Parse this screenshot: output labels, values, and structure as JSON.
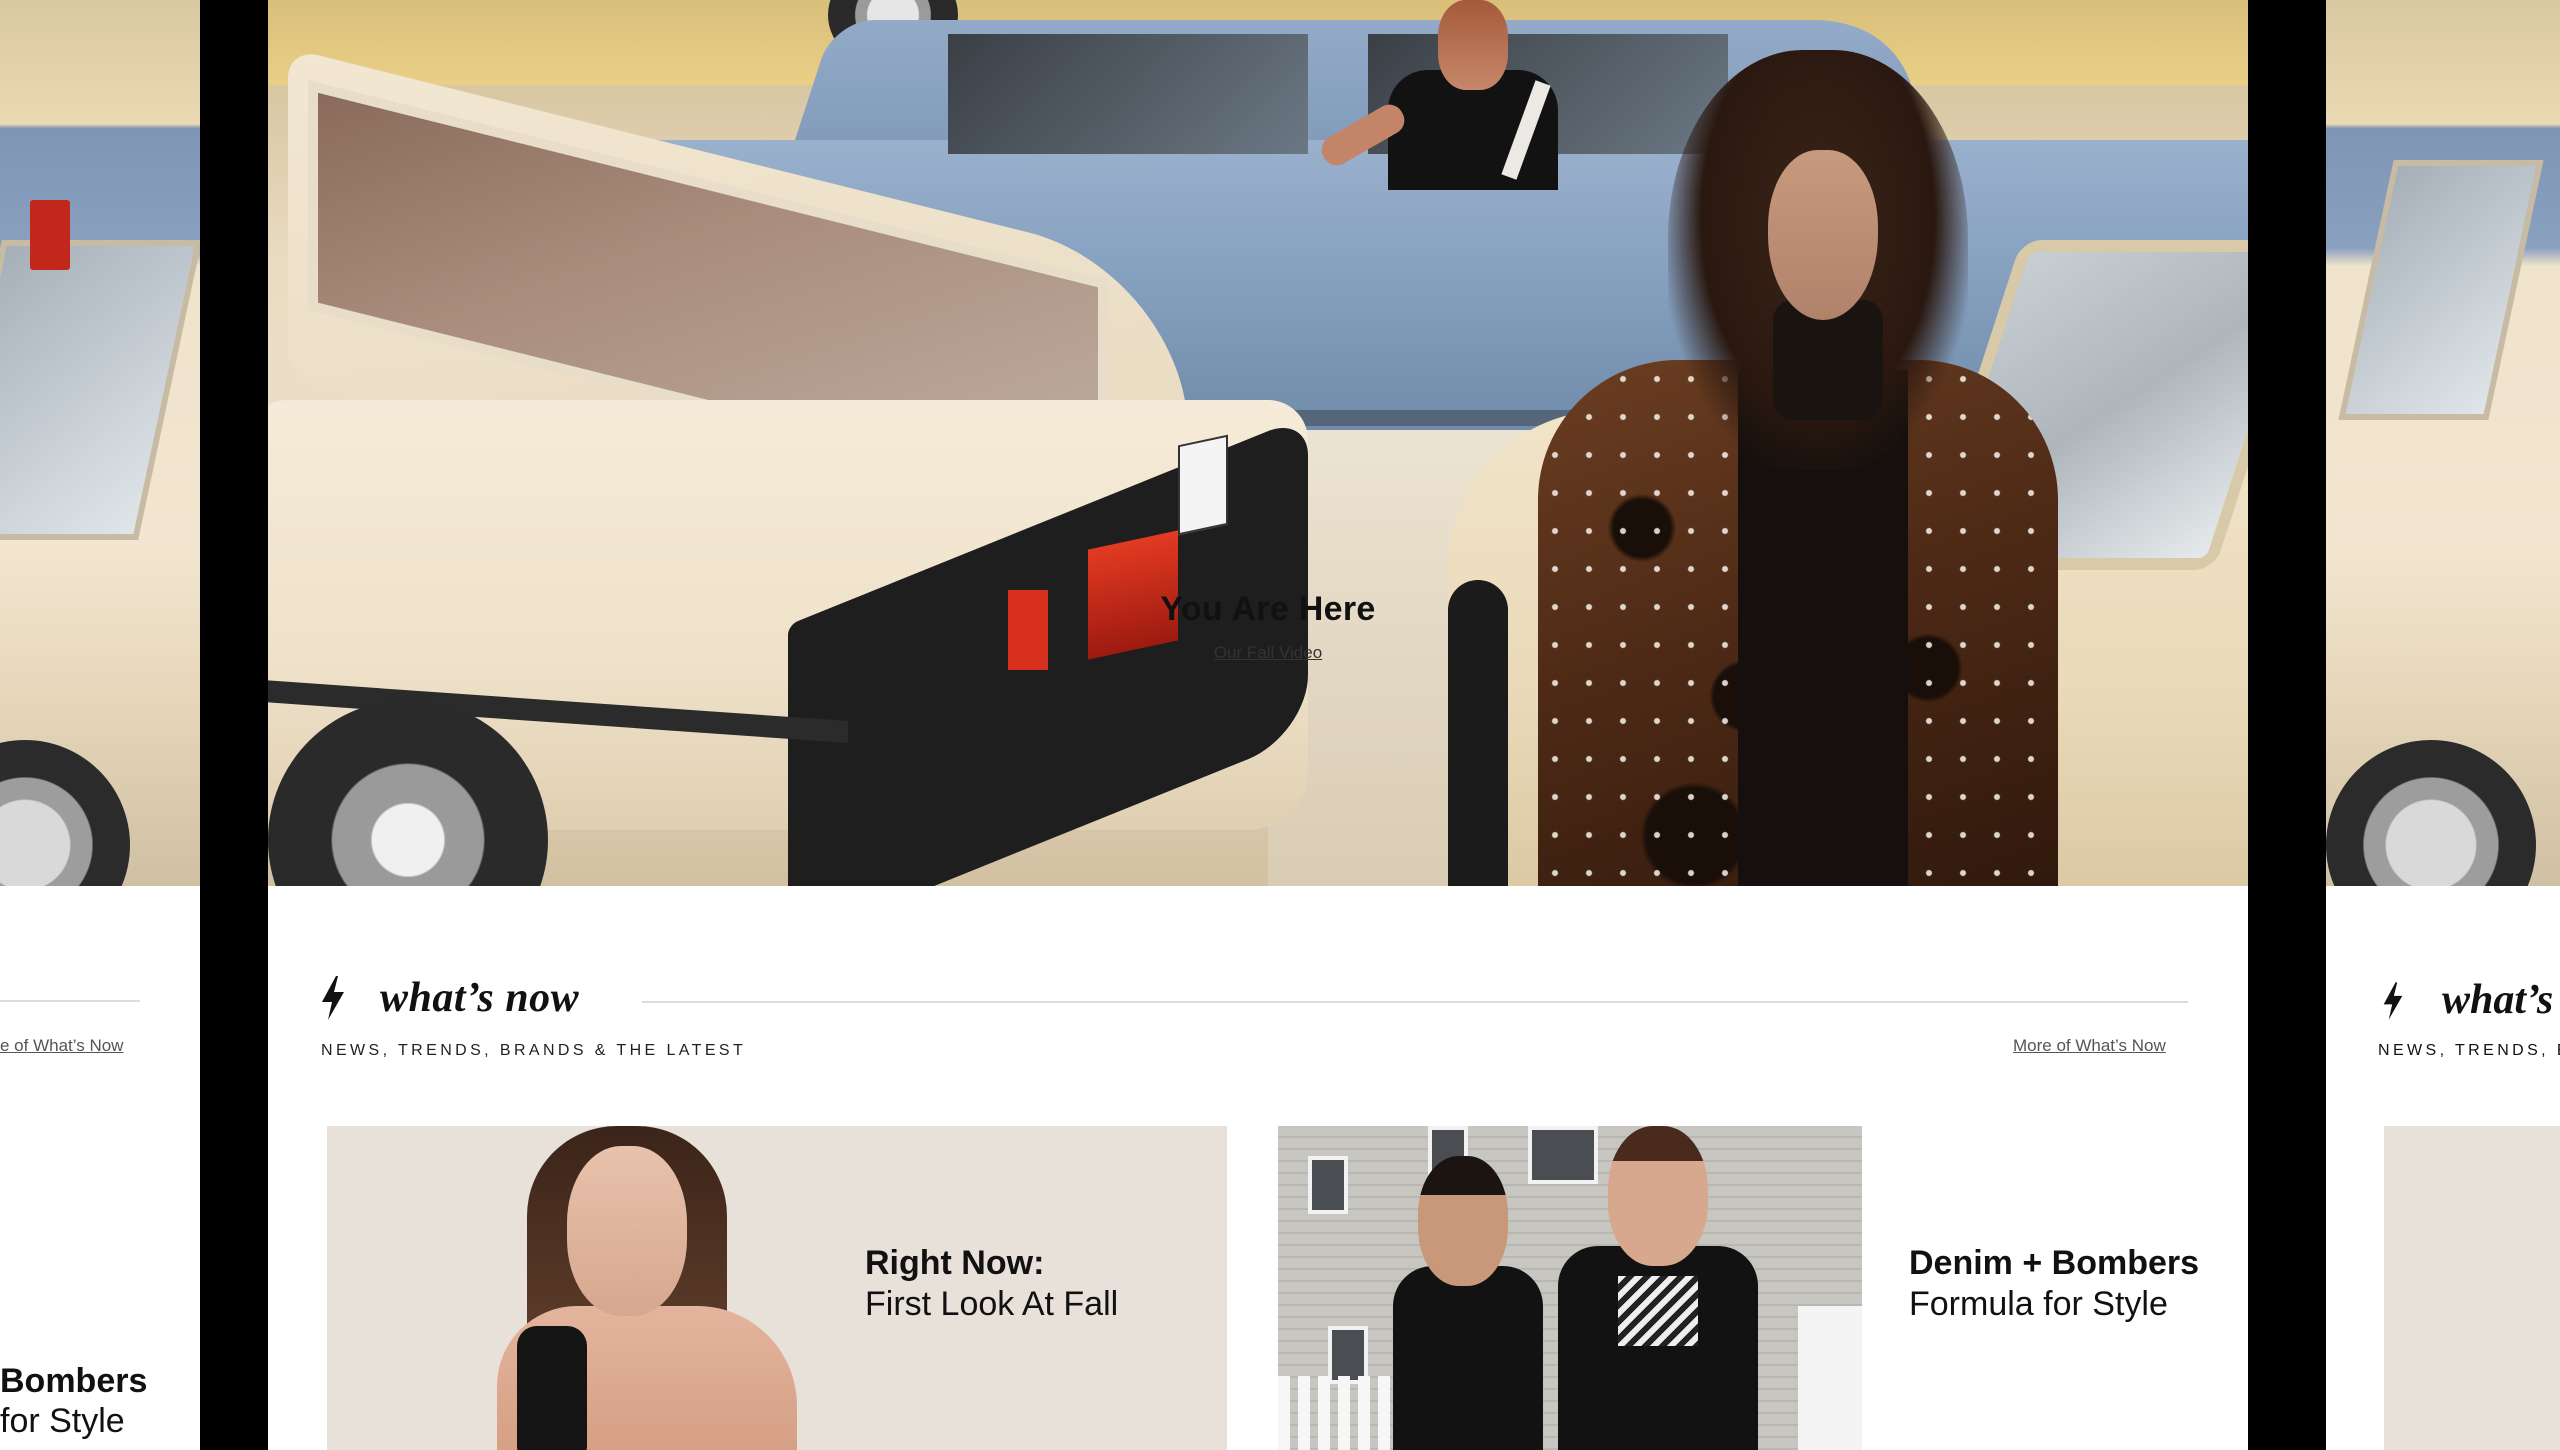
{
  "hero": {
    "title": "You Are Here",
    "link": "Our Fall Video"
  },
  "whats_now": {
    "title": "what’s now",
    "subtitle": "NEWS, TRENDS, BRANDS & THE LATEST",
    "more_link": "More of What’s Now",
    "icon": "lightning-bolt-icon"
  },
  "cards": [
    {
      "title": "Right Now:",
      "subtitle": "First Look At Fall"
    },
    {
      "title": "Denim + Bombers",
      "subtitle": "Formula for Style"
    }
  ],
  "side_left": {
    "more_link": "e of What’s Now",
    "card_title": "Bombers",
    "card_subtitle": "for Style"
  },
  "side_right": {
    "title": "what’s",
    "subtitle": "NEWS, TRENDS, E"
  },
  "colors": {
    "page_bg": "#ffffff",
    "frame": "#000000",
    "text": "#111111",
    "rule": "#dcdcdc"
  }
}
